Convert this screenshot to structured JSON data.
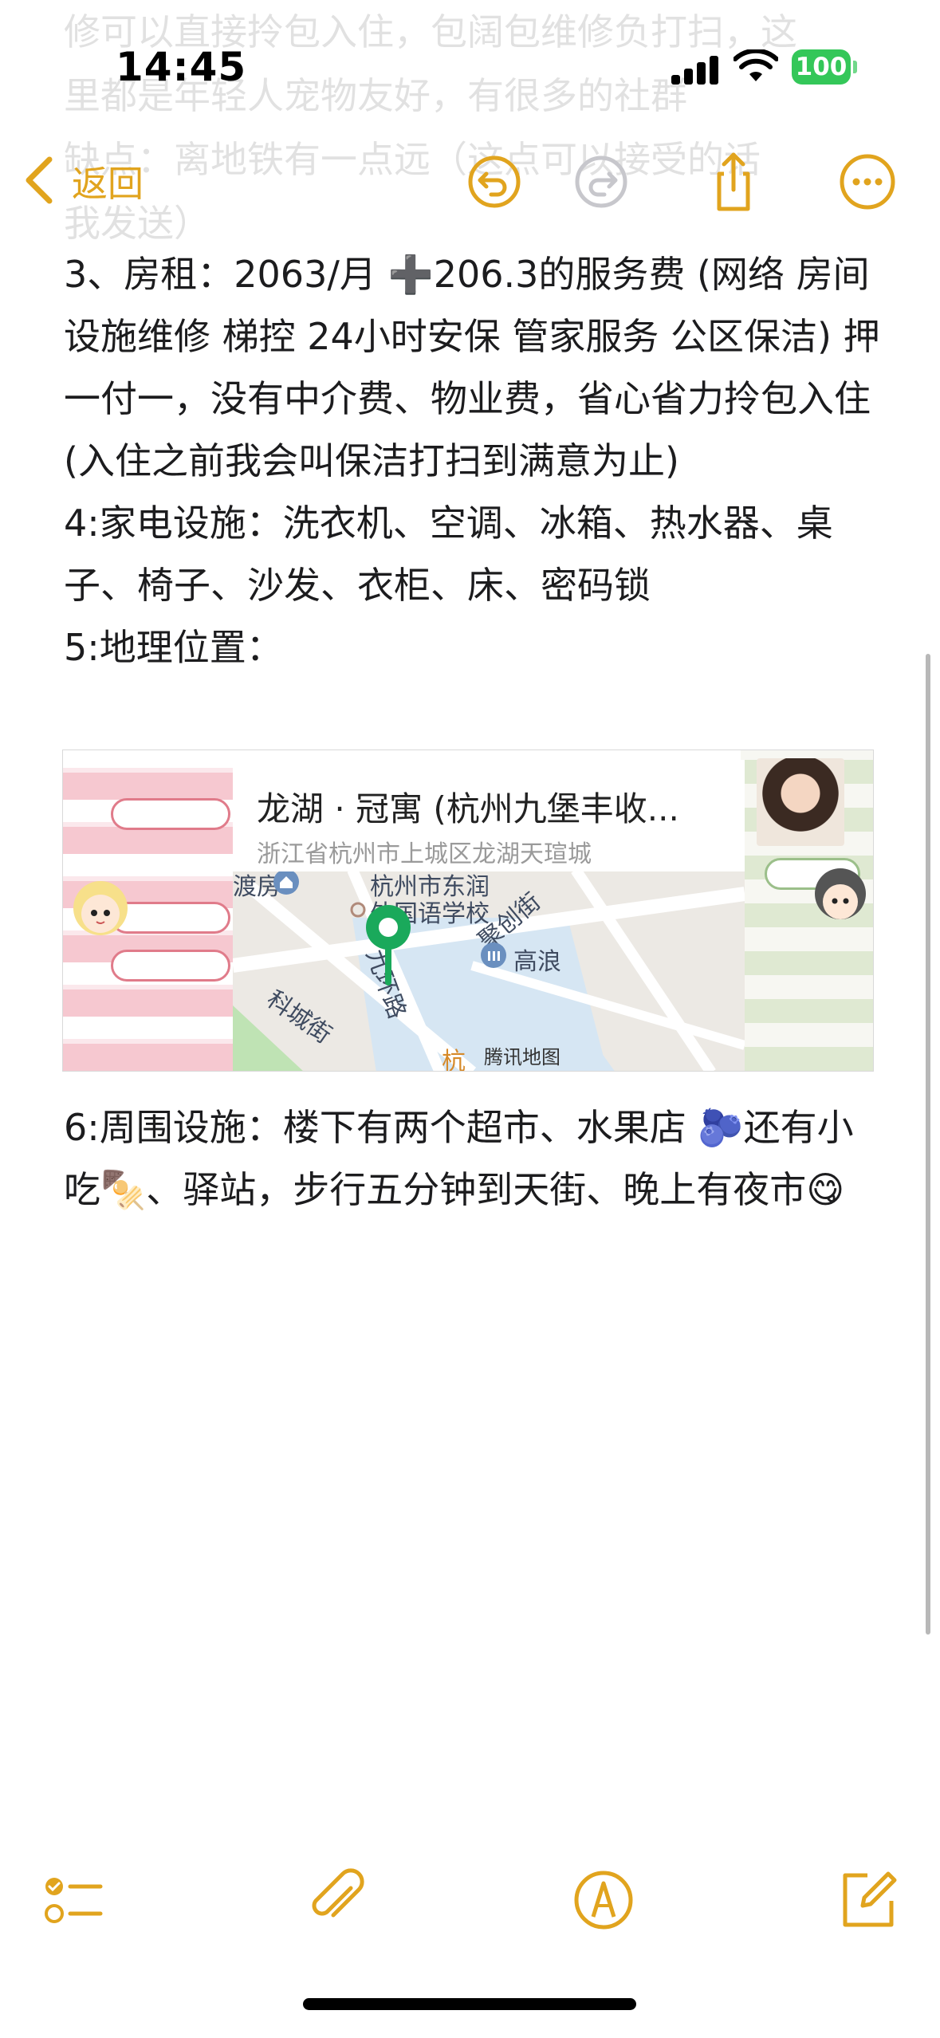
{
  "status_bar": {
    "time": "14:45",
    "battery": "100"
  },
  "scrolled_text": [
    "修可以直接拎包入住，包阔包维修负打扫，这",
    "里都是年轻人宠物友好，有很多的社群",
    "缺点：离地铁有一点远（这点可以接受的话",
    "我发送）"
  ],
  "nav": {
    "back_label": "返回",
    "accent_color": "#e1a41e"
  },
  "note": {
    "paragraphs": [
      "3、房租：2063/月 ➕206.3的服务费 (网络 房间设施维修 梯控 24小时安保 管家服务 公区保洁) 押一付一，没有中介费、物业费，省心省力拎包入住 (入住之前我会叫保洁打扫到满意为止)",
      "4:家电设施：洗衣机、空调、冰箱、热水器、桌子、椅子、沙发、衣柜、床、密码锁",
      "5:地理位置："
    ],
    "paragraph_after_map": "6:周围设施：楼下有两个超市、水果店 🫐还有小吃🍢、驿站，步行五分钟到天街、晚上有夜市😋"
  },
  "map_card": {
    "title": "龙湖 · 冠寓 (杭州九堡丰收...",
    "address": "浙江省杭州市上城区龙湖天瑄城",
    "labels": {
      "school": "杭州市东润",
      "school_line2": "外国语学校",
      "street1": "聚创街",
      "street2": "科城街",
      "road": "九环路",
      "poi_left": "渡房",
      "poi_right": "高浪",
      "bottom": "杭",
      "provider": "腾讯地图"
    },
    "pin_color": "#1aa95b"
  },
  "toolbar": {
    "items": [
      "checklist-icon",
      "attachment-icon",
      "markup-icon",
      "compose-icon"
    ]
  }
}
